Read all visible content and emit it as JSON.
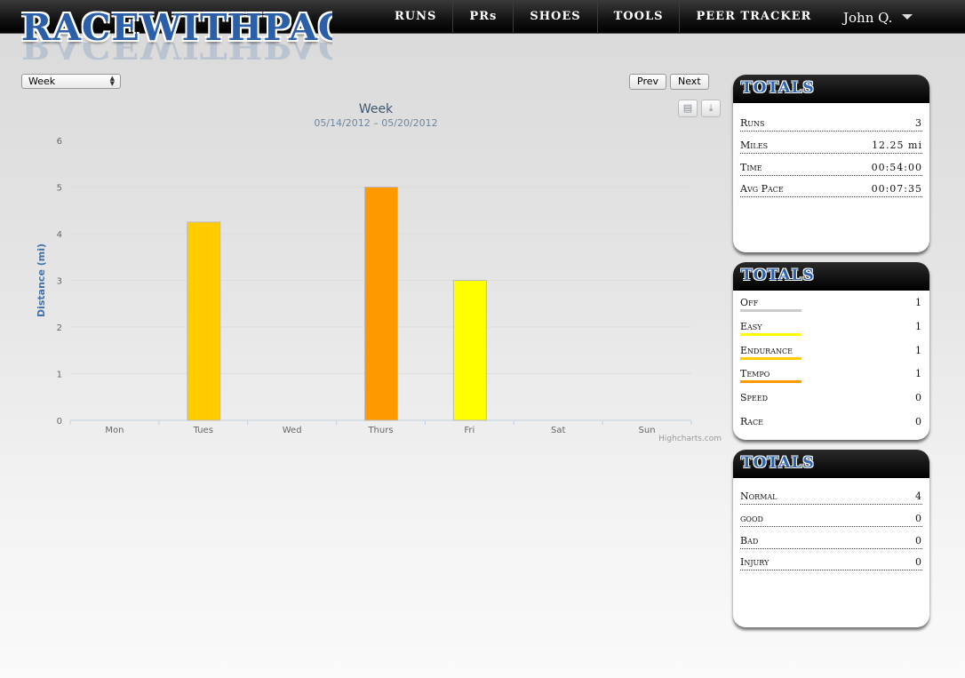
{
  "header": {
    "logo": "RACEWITHPACE",
    "nav": [
      "RUNS",
      "PRs",
      "SHOES",
      "TOOLS",
      "PEER TRACKER"
    ],
    "user": "John Q."
  },
  "controls": {
    "period_selected": "Week",
    "prev_label": "Prev",
    "next_label": "Next",
    "print_icon": "printer-icon",
    "export_icon": "download-icon"
  },
  "chart_data": {
    "type": "bar",
    "title": "Week",
    "subtitle": "05/14/2012 – 05/20/2012",
    "ylabel": "Distance (mi)",
    "xlabel": "",
    "categories": [
      "Mon",
      "Tues",
      "Wed",
      "Thurs",
      "Fri",
      "Sat",
      "Sun"
    ],
    "values": [
      0,
      4.25,
      0,
      5,
      3,
      0,
      0
    ],
    "colors": [
      "#cccccc",
      "#ffcc00",
      "#cccccc",
      "#ff9900",
      "#ffff00",
      "#cccccc",
      "#cccccc"
    ],
    "ylim": [
      0,
      6
    ],
    "yticks": [
      0,
      1,
      2,
      3,
      4,
      5,
      6
    ],
    "grid": true,
    "credit": "Highcharts.com",
    "axis_color": "#4572a7"
  },
  "totals": {
    "title": "TOTALS",
    "rows": [
      {
        "label": "Runs",
        "value": "3"
      },
      {
        "label": "Miles",
        "value": "12.25 mi"
      },
      {
        "label": "Time",
        "value": "00:54:00"
      },
      {
        "label": "Avg Pace",
        "value": "00:07:35"
      }
    ]
  },
  "types": {
    "title": "TOTALS",
    "rows": [
      {
        "label": "Off",
        "value": "1",
        "color": "#cccccc"
      },
      {
        "label": "Easy",
        "value": "1",
        "color": "#ffff00"
      },
      {
        "label": "Endurance",
        "value": "1",
        "color": "#ffcc00"
      },
      {
        "label": "Tempo",
        "value": "1",
        "color": "#ff9900"
      },
      {
        "label": "Speed",
        "value": "0"
      },
      {
        "label": "Race",
        "value": "0"
      }
    ]
  },
  "feel": {
    "title": "TOTALS",
    "rows": [
      {
        "label": "Normal",
        "value": "4"
      },
      {
        "label": "good",
        "value": "0"
      },
      {
        "label": "Bad",
        "value": "0"
      },
      {
        "label": "Injury",
        "value": "0"
      }
    ]
  }
}
